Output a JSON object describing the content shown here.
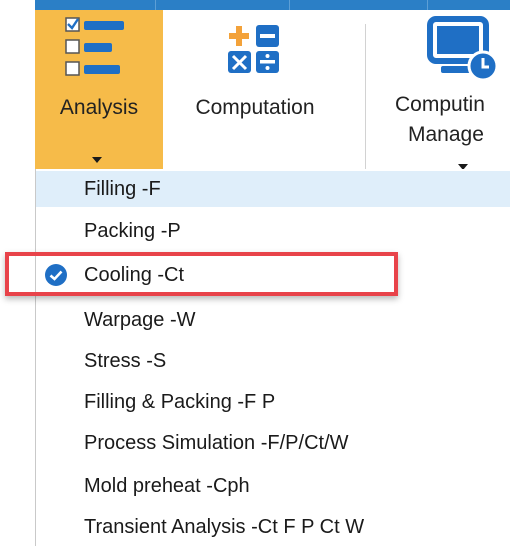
{
  "ribbon": {
    "analysis": {
      "label": "Analysis",
      "icon": "checklist-icon",
      "active_color": "#f6bb49"
    },
    "computation": {
      "label": "Computation",
      "icon": "calculator-icon"
    },
    "computing_manager": {
      "label_line1": "Computin",
      "label_line2": "Manage",
      "icon": "monitor-clock-icon"
    }
  },
  "menu": {
    "items": [
      {
        "label": "Filling -F",
        "hovered": true,
        "checked": false
      },
      {
        "label": "Packing -P",
        "hovered": false,
        "checked": false
      },
      {
        "label": "Cooling -Ct",
        "hovered": false,
        "checked": true
      },
      {
        "label": "Warpage -W",
        "hovered": false,
        "checked": false
      },
      {
        "label": "Stress -S",
        "hovered": false,
        "checked": false
      },
      {
        "label": "Filling & Packing -F P",
        "hovered": false,
        "checked": false
      },
      {
        "label": "Process Simulation -F/P/Ct/W",
        "hovered": false,
        "checked": false
      },
      {
        "label": "Mold preheat -Cph",
        "hovered": false,
        "checked": false
      },
      {
        "label": "Transient Analysis -Ct F P Ct W",
        "hovered": false,
        "checked": false
      }
    ],
    "check_icon": "check-circle-icon"
  },
  "annotation": {
    "highlight_color": "#e8434a"
  },
  "colors": {
    "accent_blue": "#2b7fc6",
    "icon_orange": "#f3a23a",
    "hover_bg": "#dfeefa"
  }
}
